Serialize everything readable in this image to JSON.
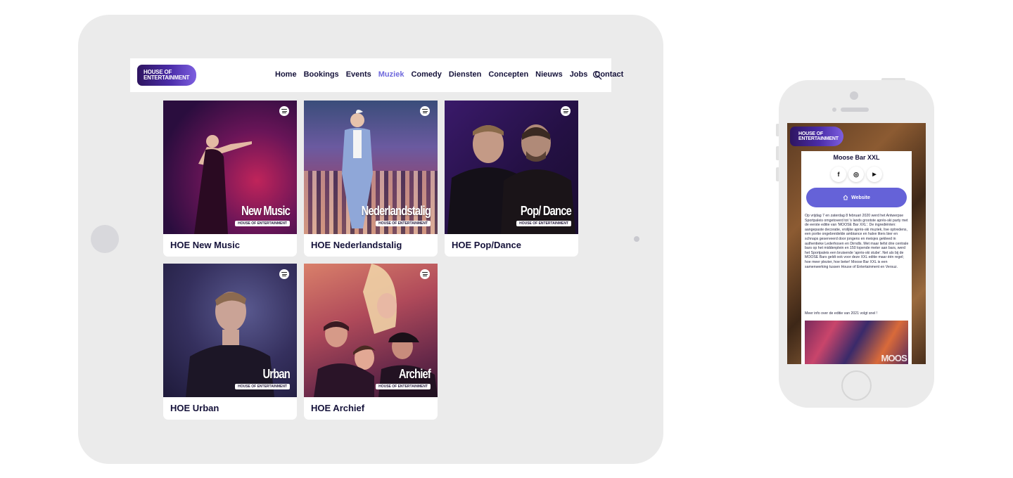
{
  "tablet": {
    "logo": {
      "line1": "HOUSE OF",
      "line2": "ENTERTAINMENT"
    },
    "nav": {
      "items": [
        "Home",
        "Bookings",
        "Events",
        "Muziek",
        "Comedy",
        "Diensten",
        "Concepten",
        "Nieuws",
        "Jobs",
        "Contact"
      ],
      "active": "Muziek",
      "search_icon": "search-icon"
    },
    "cards": [
      {
        "title": "HOE New Music",
        "cover_name": "New Music",
        "cover_tag": "HOUSE OF ENTERTAINMENT",
        "icon": "spotify-icon"
      },
      {
        "title": "HOE Nederlandstalig",
        "cover_name": "Nederlandstalig",
        "cover_tag": "HOUSE OF ENTERTAINMENT",
        "icon": "spotify-icon"
      },
      {
        "title": "HOE Pop/Dance",
        "cover_name": "Pop/ Dance",
        "cover_tag": "HOUSE OF ENTERTAINMENT",
        "icon": "spotify-icon"
      },
      {
        "title": "HOE Urban",
        "cover_name": "Urban",
        "cover_tag": "HOUSE OF ENTERTAINMENT",
        "icon": "spotify-icon"
      },
      {
        "title": "HOE Archief",
        "cover_name": "Archief",
        "cover_tag": "HOUSE OF ENTERTAINMENT",
        "icon": "spotify-icon"
      }
    ]
  },
  "phone": {
    "logo": {
      "line1": "HOUSE OF",
      "line2": "ENTERTAINMENT"
    },
    "title": "Moose Bar XXL",
    "socials": {
      "facebook": "f",
      "instagram": "◎",
      "youtube": "▶"
    },
    "website_label": "Website",
    "body": "Op vrijdag 7 en zaterdag 8 februari 2020 werd het Antwerpse Sportpaleis omgetoverd tot 's lands grootste après-ski party met de eerste editie van 'MOOSE Bar XXL'. De ingrediënten: aangepaste decoratie, vrolijke après-ski muziek, live optredens, een portie ongebreidelde ambiance en halve liters bier en schnaps geserveerd door jongens en meisjes gekleed in authentieke Lederhosen en Dirndls. Met maar liefst drie centrale bars op het middenplein en 150 lopende meter aan bars, werd het Sportpaleis een bruisende 'après-ski stube'. Net als bij de MOOSE Bars geldt ook voor deze XXL editie maar één regel; hoe meer plezier, hoe beter! Moose Bar XXL is een samenwerking tussen House of Entertainment en Versuz.",
    "more": "Meer info over de editie van 2021 volgt snel !",
    "image_label": "MOOS"
  },
  "colors": {
    "accent": "#6f69dc",
    "button": "#6562d8",
    "text_dark": "#15123a",
    "device": "#ebebeb"
  }
}
